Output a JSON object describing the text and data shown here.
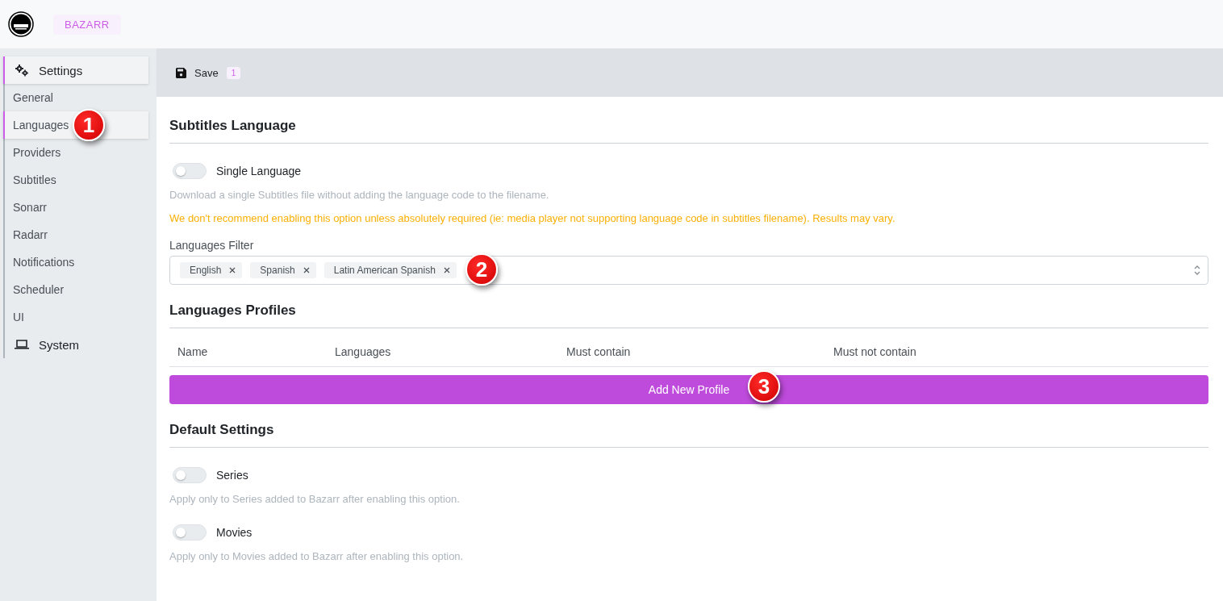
{
  "header": {
    "brand": "BAZARR"
  },
  "sidebar": {
    "items": [
      {
        "label": "Settings",
        "kind": "settings",
        "expanded": true,
        "children": [
          {
            "label": "General",
            "selected": false
          },
          {
            "label": "Languages",
            "selected": true,
            "callout": "1"
          },
          {
            "label": "Providers",
            "selected": false
          },
          {
            "label": "Subtitles",
            "selected": false
          },
          {
            "label": "Sonarr",
            "selected": false
          },
          {
            "label": "Radarr",
            "selected": false
          },
          {
            "label": "Notifications",
            "selected": false
          },
          {
            "label": "Scheduler",
            "selected": false
          },
          {
            "label": "UI",
            "selected": false
          }
        ]
      },
      {
        "label": "System",
        "kind": "system",
        "expanded": false
      }
    ]
  },
  "toolbar": {
    "save": "Save",
    "badge": "1"
  },
  "sections": [
    {
      "title": "Subtitles Language",
      "items": [
        {
          "kind": "toggle",
          "label": "Single Language",
          "on": false
        },
        {
          "kind": "hint",
          "text": "Download a single Subtitles file without adding the language code to the filename."
        },
        {
          "kind": "warning",
          "text": "We don't recommend enabling this option unless absolutely required (ie: media player not supporting language code in subtitles filename). Results may vary."
        },
        {
          "kind": "multiselect",
          "label": "Languages Filter",
          "callout": "2",
          "values": [
            "English",
            "Spanish",
            "Latin American Spanish"
          ]
        }
      ]
    },
    {
      "title": "Languages Profiles",
      "items": [
        {
          "kind": "table",
          "columns": [
            "Name",
            "Languages",
            "Must contain",
            "Must not contain"
          ]
        },
        {
          "kind": "button",
          "label": "Add New Profile",
          "callout": "3"
        }
      ]
    },
    {
      "title": "Default Settings",
      "items": [
        {
          "kind": "toggle",
          "label": "Series",
          "on": false
        },
        {
          "kind": "hint",
          "text": "Apply only to Series added to Bazarr after enabling this option."
        },
        {
          "kind": "toggle",
          "label": "Movies",
          "on": false
        },
        {
          "kind": "hint",
          "text": "Apply only to Movies added to Bazarr after enabling this option."
        }
      ]
    }
  ]
}
